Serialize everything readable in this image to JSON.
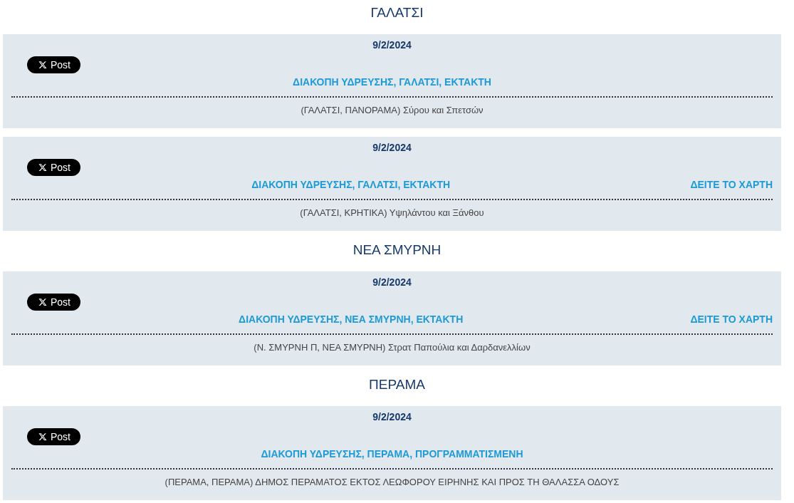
{
  "sections": [
    {
      "heading": "ΓΑΛΑΤΣΙ",
      "items": [
        {
          "date": "9/2/2024",
          "share_label": "Post",
          "title": "ΔΙΑΚΟΠΗ ΥΔΡΕΥΣΗΣ, ΓΑΛΑΤΣΙ, ΕΚΤΑΚΤΗ",
          "address": "(ΓΑΛΑΤΣΙ, ΠΑΝΟΡΑΜΑ) Σύρου και Σπετσών"
        },
        {
          "date": "9/2/2024",
          "share_label": "Post",
          "title": "ΔΙΑΚΟΠΗ ΥΔΡΕΥΣΗΣ, ΓΑΛΑΤΣΙ, ΕΚΤΑΚΤΗ",
          "map_link": "ΔΕΙΤΕ ΤΟ ΧΑΡΤΗ",
          "address": "(ΓΑΛΑΤΣΙ, ΚΡΗΤΙΚΑ) Υψηλάντου και Ξάνθου"
        }
      ]
    },
    {
      "heading": "ΝΕΑ ΣΜΥΡΝΗ",
      "items": [
        {
          "date": "9/2/2024",
          "share_label": "Post",
          "title": "ΔΙΑΚΟΠΗ ΥΔΡΕΥΣΗΣ, ΝΕΑ ΣΜΥΡΝΗ, ΕΚΤΑΚΤΗ",
          "map_link": "ΔΕΙΤΕ ΤΟ ΧΑΡΤΗ",
          "address": "(Ν. ΣΜΥΡΝΗ Π, ΝΕΑ ΣΜΥΡΝΗ) Στρατ Παπούλια και Δαρδανελλίων"
        }
      ]
    },
    {
      "heading": "ΠΕΡΑΜΑ",
      "items": [
        {
          "date": "9/2/2024",
          "share_label": "Post",
          "title": "ΔΙΑΚΟΠΗ ΥΔΡΕΥΣΗΣ, ΠΕΡΑΜΑ, ΠΡΟΓΡΑΜΜΑΤΙΣΜΕΝΗ",
          "address": "(ΠΕΡΑΜΑ, ΠΕΡΑΜΑ) ΔΗΜΟΣ ΠΕΡΑΜΑΤΟΣ ΕΚΤΟΣ ΛΕΩΦΟΡΟΥ ΕΙΡΗΝΗΣ ΚΑΙ ΠΡΟΣ ΤΗ ΘΑΛΑΣΣΑ ΟΔΟΥΣ"
        }
      ]
    }
  ]
}
